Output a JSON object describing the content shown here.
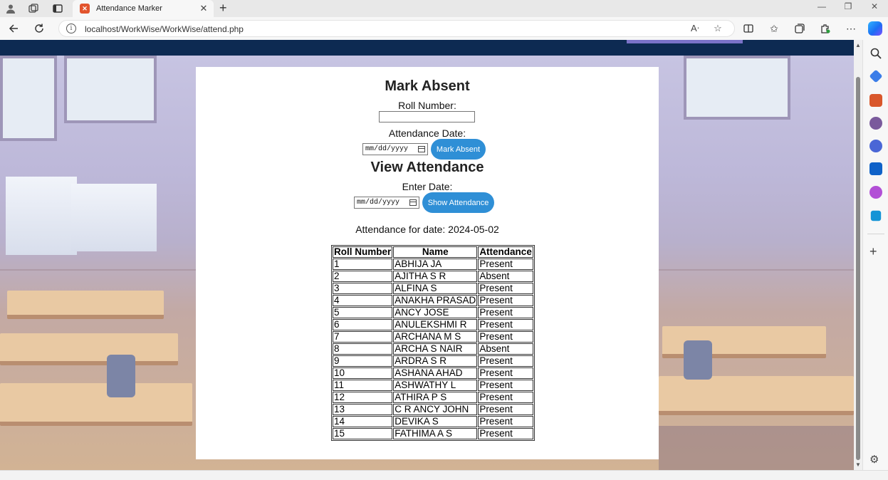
{
  "browser": {
    "tab_title": "Attendance Marker",
    "url": "localhost/WorkWise/WorkWise/attend.php"
  },
  "icons": {
    "profile": "profile-icon",
    "workspaces": "workspaces-icon",
    "tab_actions": "tab-actions-icon",
    "back": "back-arrow-icon",
    "refresh": "refresh-icon",
    "read_aloud": "read-aloud-icon",
    "favorite": "star-icon",
    "split": "split-screen-icon",
    "favorites": "favorites-icon",
    "collections": "collections-icon",
    "extensions": "extensions-icon",
    "more": "more-icon",
    "copilot": "copilot-icon"
  },
  "colors": {
    "nav_bar": "#0d2a52",
    "button": "#2f8fd6",
    "nav_accent": "#7a72c8"
  },
  "mark_absent": {
    "heading": "Mark Absent",
    "roll_label": "Roll Number:",
    "roll_value": "",
    "date_label": "Attendance Date:",
    "date_placeholder": "mm/dd/yyyy",
    "button": "Mark Absent"
  },
  "view_attendance": {
    "heading": "View Attendance",
    "date_label": "Enter Date:",
    "date_placeholder": "mm/dd/yyyy",
    "button": "Show Attendance"
  },
  "result": {
    "caption": "Attendance for date: 2024-05-02",
    "headers": [
      "Roll Number",
      "Name",
      "Attendance"
    ],
    "rows": [
      [
        "1",
        "ABHIJA JA",
        "Present"
      ],
      [
        "2",
        "AJITHA S R",
        "Absent"
      ],
      [
        "3",
        "ALFINA S",
        "Present"
      ],
      [
        "4",
        "ANAKHA PRASAD",
        "Present"
      ],
      [
        "5",
        "ANCY JOSE",
        "Present"
      ],
      [
        "6",
        "ANULEKSHMI R",
        "Present"
      ],
      [
        "7",
        "ARCHANA M S",
        "Present"
      ],
      [
        "8",
        "ARCHA S NAIR",
        "Absent"
      ],
      [
        "9",
        "ARDRA S R",
        "Present"
      ],
      [
        "10",
        "ASHANA AHAD",
        "Present"
      ],
      [
        "11",
        "ASHWATHY L",
        "Present"
      ],
      [
        "12",
        "ATHIRA P S",
        "Present"
      ],
      [
        "13",
        "C R ANCY JOHN",
        "Present"
      ],
      [
        "14",
        "DEVIKA S",
        "Present"
      ],
      [
        "15",
        "FATHIMA A S",
        "Present"
      ]
    ]
  }
}
